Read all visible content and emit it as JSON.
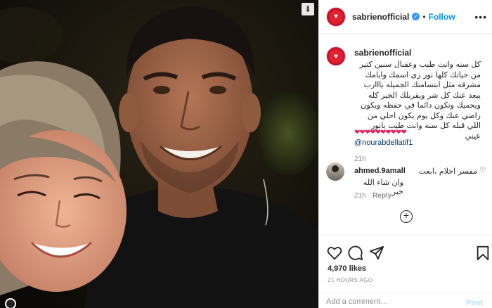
{
  "post": {
    "username": "sabrienofficial",
    "follow_label": "Follow",
    "separator": "•",
    "more_label": "•••",
    "download_icon": "⬇"
  },
  "caption": {
    "username": "sabrienofficial",
    "text": "كل سنه وانت طيب وعقبال سنين كتير من حياتك كلها نور زي اسمك وايامك مشرقه مثل ابتسامتك الجميله يااارب يبعد عنك كل شر ويقربلك الخير كله ويحميك وتكون دائما في حفظه ويكون راضي عنك وكل يوم يكون احلي من اللي قبله كل سنه وانت طيب يانور عيني",
    "hearts": "❤❤❤❤❤❤❤❤❤❤",
    "mention": "@nourabdellatif1",
    "time": "21h"
  },
  "comment": {
    "username": "ahmed.9amall",
    "text_line1": "مفسر احلام ،ابعت",
    "text_line2": "وان شاء الله خير",
    "time": "21h",
    "reply_label": "Reply"
  },
  "stats": {
    "likes": "4,970 likes",
    "posted": "21 HOURS AGO"
  },
  "add_comment": {
    "placeholder": "Add a comment…",
    "post_label": "Post"
  },
  "colors": {
    "accent": "#0095f6",
    "verified": "#3897f0",
    "avatar_red": "#c8102e"
  },
  "icons": [
    "heart-icon",
    "comment-icon",
    "share-icon",
    "bookmark-icon",
    "add-circle-icon",
    "verified-badge-icon",
    "download-icon"
  ]
}
